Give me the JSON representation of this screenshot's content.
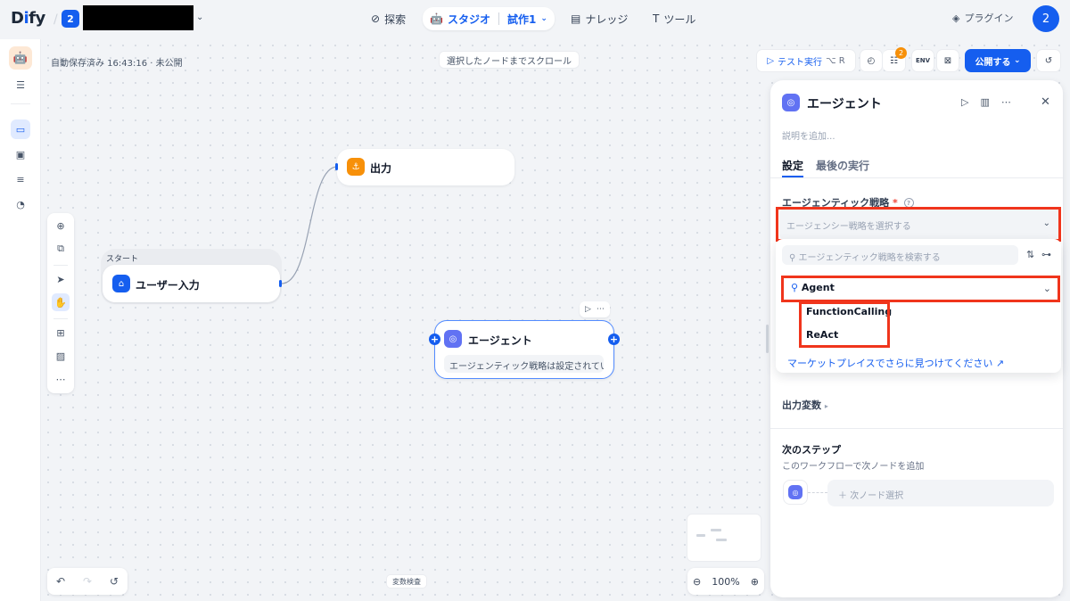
{
  "header": {
    "logo_main": "D",
    "logo_accent": "i",
    "logo_rest": "fy",
    "workspace_badge": "2",
    "nav": {
      "explore": "探索",
      "studio": "スタジオ",
      "app_name": "試作1",
      "knowledge": "ナレッジ",
      "tools": "ツール"
    },
    "plugins": "プラグイン",
    "avatar": "2"
  },
  "toolbar": {
    "autosave": "自動保存済み 16:43:16 · 未公開",
    "scroll_to_node": "選択したノードまでスクロール",
    "test_run": "テスト実行",
    "test_run_kbd": "⌥ R",
    "checklist_count": "2",
    "env": "ENV",
    "publish": "公開する"
  },
  "nodes": {
    "start_label": "スタート",
    "user_input": "ユーザー入力",
    "output": "出力",
    "agent": "エージェント",
    "agent_sub": "エージェンティック戦略は設定されていません"
  },
  "zoom": "100%",
  "variable_check": "変数検査",
  "panel": {
    "title": "エージェント",
    "description_placeholder": "説明を追加...",
    "tabs": [
      "設定",
      "最後の実行"
    ],
    "strategy_label": "エージェンティック戦略",
    "required_mark": "*",
    "strategy_placeholder": "エージェンシー戦略を選択する",
    "search_placeholder": "エージェンティック戦略を検索する",
    "group_name": "Agent",
    "options": [
      "FunctionCalling",
      "ReAct"
    ],
    "marketplace_link": "マーケットプレイスでさらに見つけてください ↗",
    "output_vars": "出力変数",
    "next_step_title": "次のステップ",
    "next_step_desc": "このワークフローで次ノードを追加",
    "next_node_select": "次ノード選択"
  },
  "colors": {
    "accent": "#155eef",
    "highlight": "#f0351c",
    "agent_icon": "#6172f3",
    "output_icon": "#f79009"
  }
}
